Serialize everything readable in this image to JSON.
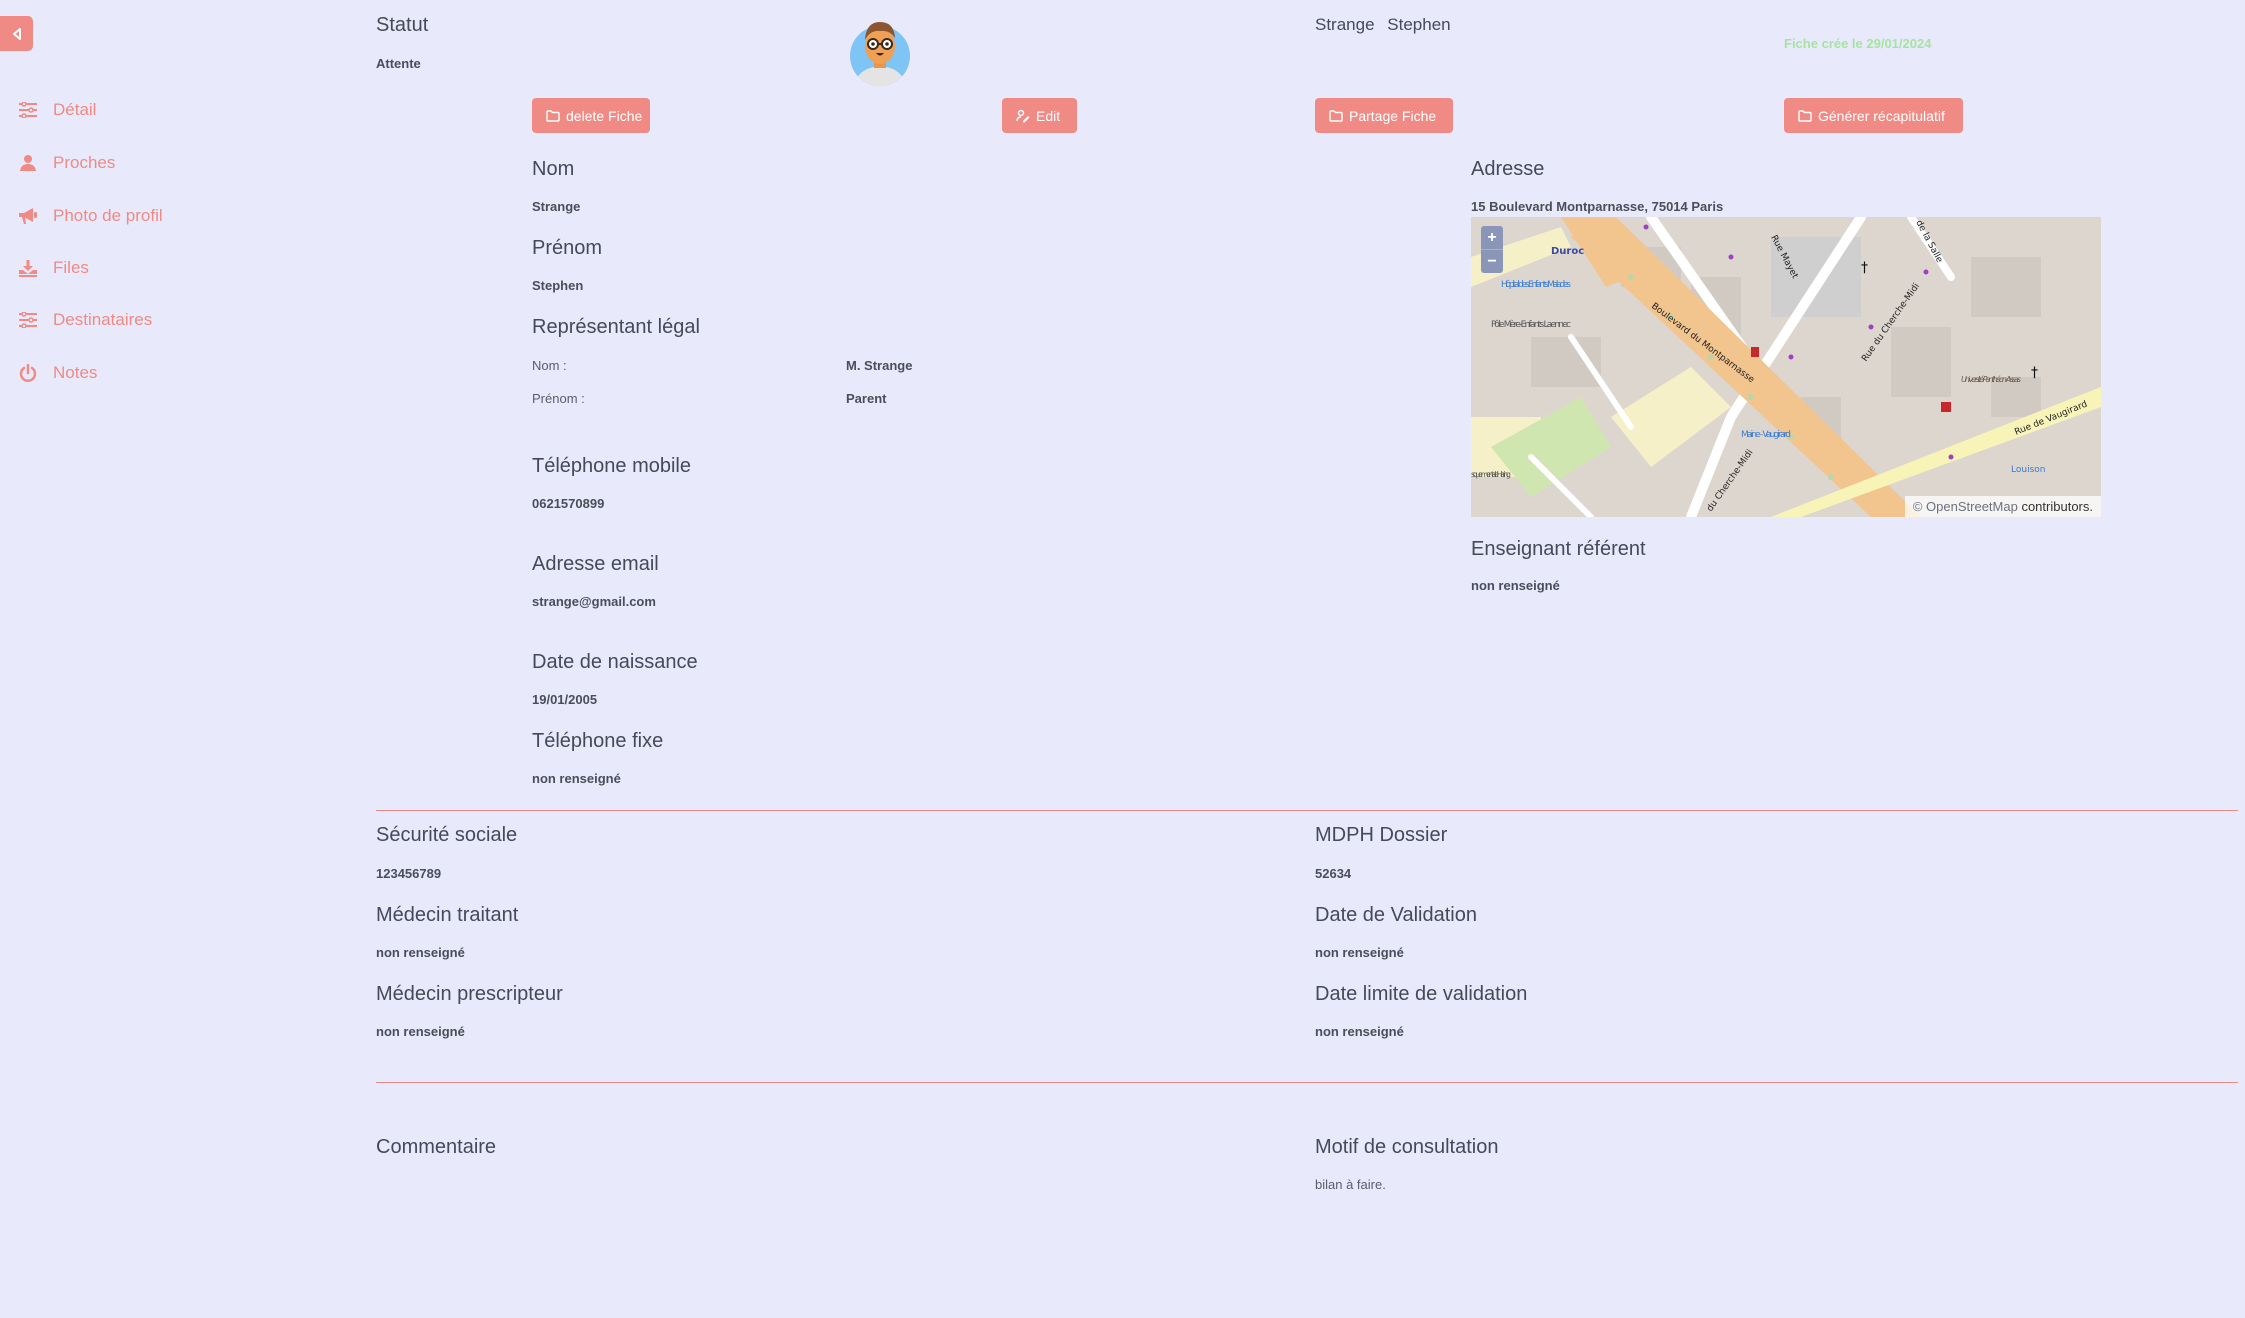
{
  "sidebar": {
    "toggle_icon": "caret-left-icon",
    "items": [
      {
        "label": "Détail",
        "icon": "sliders-icon"
      },
      {
        "label": "Proches",
        "icon": "user-icon"
      },
      {
        "label": "Photo de profil",
        "icon": "megaphone-icon"
      },
      {
        "label": "Files",
        "icon": "download-tray-icon"
      },
      {
        "label": "Destinataires",
        "icon": "sliders-icon"
      },
      {
        "label": "Notes",
        "icon": "power-icon"
      }
    ]
  },
  "header": {
    "status_title": "Statut",
    "status_value": "Attente",
    "last_name": "Strange",
    "first_name": "Stephen",
    "created": "Fiche crée le 29/01/2024",
    "avatar": "avatar-cartoon-glasses"
  },
  "actions": {
    "delete": "delete Fiche",
    "edit": "Edit",
    "share": "Partage Fiche",
    "generate": "Générer récapitulatif"
  },
  "identity": {
    "nom_label": "Nom",
    "nom_value": "Strange",
    "prenom_label": "Prénom",
    "prenom_value": "Stephen",
    "rep_label": "Représentant légal",
    "rep_nom_label": "Nom :",
    "rep_nom_value": "M. Strange",
    "rep_prenom_label": "Prénom :",
    "rep_prenom_value": "Parent",
    "mobile_label": "Téléphone mobile",
    "mobile_value": "0621570899",
    "email_label": "Adresse email",
    "email_value": "strange@gmail.com",
    "birth_label": "Date de naissance",
    "birth_value": "19/01/2005",
    "fixe_label": "Téléphone fixe",
    "fixe_value": "non renseigné"
  },
  "address": {
    "label": "Adresse",
    "value": "15 Boulevard Montparnasse, 75014 Paris",
    "map": {
      "zoom_in": "+",
      "zoom_out": "−",
      "attribution_prefix": "©",
      "attribution_link": "OpenStreetMap",
      "attribution_suffix": "contributors.",
      "labels": {
        "duroc": "Duroc",
        "hopital": "Hôpital des Enfants Malades",
        "pole": "Pôle Mère-Enfants Laennec",
        "bd": "Boulevard du Montparnasse",
        "mayet": "Rue Mayet",
        "cherche1": "Rue du Cherche-Midi",
        "cherche2": "du Cherche-Midi",
        "vaugirard": "Rue de Vaugirard",
        "salle": "de la Salle",
        "univ": "Université Panthéon-Assas",
        "maine": "Maine - Vaugirard",
        "louison": "Louison",
        "haring": "sque mentale Haring"
      }
    }
  },
  "teacher": {
    "label": "Enseignant référent",
    "value": "non renseigné"
  },
  "medical": {
    "secu_label": "Sécurité sociale",
    "secu_value": "123456789",
    "traitant_label": "Médecin traitant",
    "traitant_value": "non renseigné",
    "prescripteur_label": "Médecin prescripteur",
    "prescripteur_value": "non renseigné",
    "mdph_label": "MDPH Dossier",
    "mdph_value": "52634",
    "validation_label": "Date de Validation",
    "validation_value": "non renseigné",
    "limit_label": "Date limite de validation",
    "limit_value": "non renseigné"
  },
  "notes": {
    "comment_label": "Commentaire",
    "comment_value": "",
    "motif_label": "Motif de consultation",
    "motif_value": "bilan à faire."
  },
  "colors": {
    "accent": "#f08a84",
    "background": "#e8eafc",
    "created_text": "#a6e3a1",
    "divider": "#e88a8a"
  }
}
